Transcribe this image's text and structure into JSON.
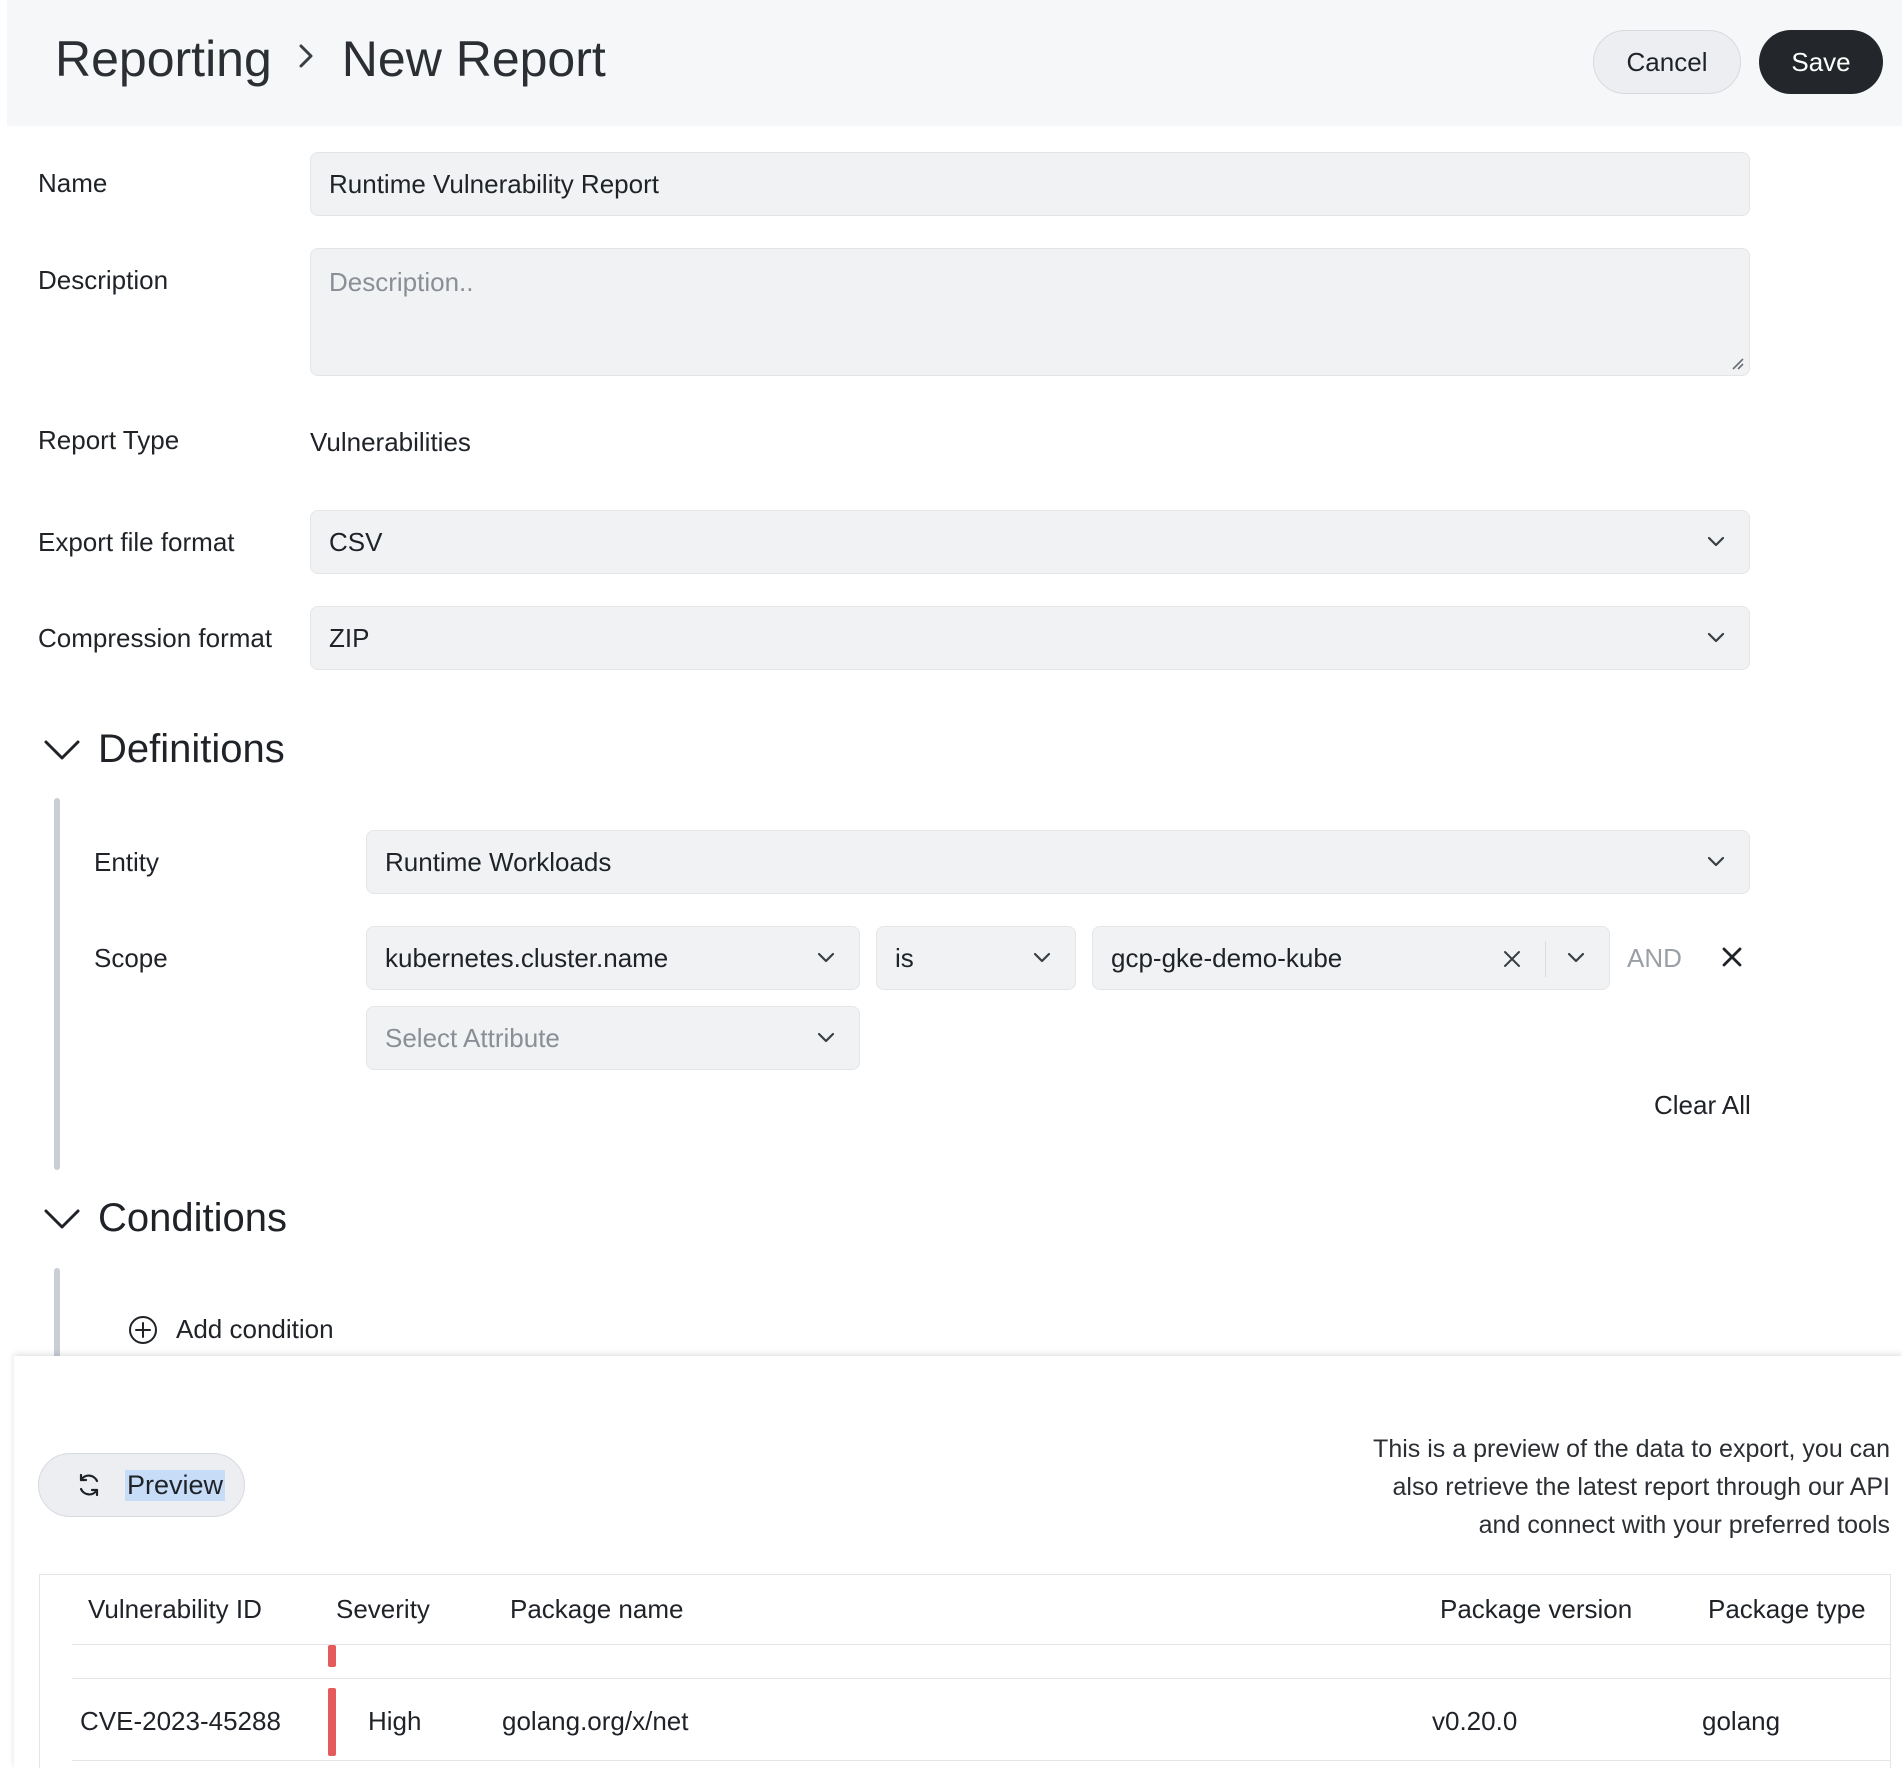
{
  "header": {
    "breadcrumb_root": "Reporting",
    "breadcrumb_current": "New Report",
    "cancel_label": "Cancel",
    "save_label": "Save"
  },
  "form": {
    "name_label": "Name",
    "name_value": "Runtime Vulnerability Report",
    "description_label": "Description",
    "description_placeholder": "Description..",
    "report_type_label": "Report Type",
    "report_type_value": "Vulnerabilities",
    "export_label": "Export file format",
    "export_value": "CSV",
    "compression_label": "Compression format",
    "compression_value": "ZIP"
  },
  "definitions": {
    "title": "Definitions",
    "entity_label": "Entity",
    "entity_value": "Runtime Workloads",
    "scope_label": "Scope",
    "scope_attribute": "kubernetes.cluster.name",
    "scope_operator": "is",
    "scope_value": "gcp-gke-demo-kube",
    "and_label": "AND",
    "select_attribute_placeholder": "Select Attribute",
    "clear_all_label": "Clear All"
  },
  "conditions": {
    "title": "Conditions",
    "add_condition_label": "Add condition"
  },
  "preview": {
    "button_label": "Preview",
    "info_line1": "This is a preview of the data to export, you can",
    "info_line2": "also retrieve the latest report through our API",
    "info_line3": "and connect with your preferred tools"
  },
  "table": {
    "columns": [
      "Vulnerability ID",
      "Severity",
      "Package name",
      "Package version",
      "Package type"
    ],
    "rows": [
      {
        "id": "CVE-2023-45288",
        "severity": "High",
        "package_name": "golang.org/x/net",
        "package_version": "v0.20.0",
        "package_type": "golang",
        "severity_color": "#e55a5a"
      }
    ]
  },
  "icons": {
    "chevron": "chevron-down-icon",
    "clear": "close-icon",
    "remove": "close-icon",
    "add": "plus-circle-icon",
    "refresh": "refresh-icon"
  }
}
